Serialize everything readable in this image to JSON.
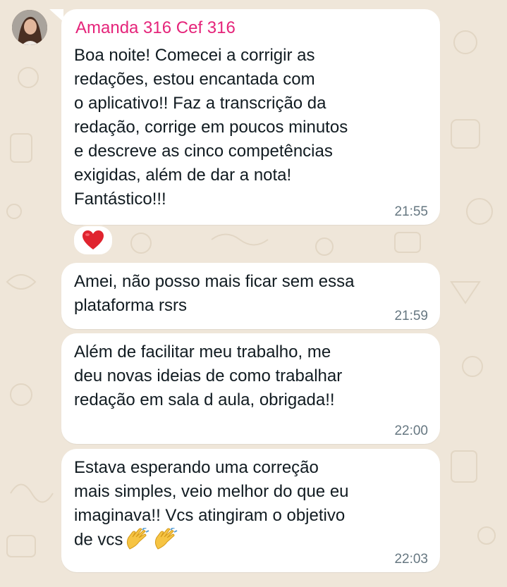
{
  "chat": {
    "sender_name": "Amanda 316 Cef 316",
    "messages": [
      {
        "text": "Boa noite! Comecei a corrigir as\nredações, estou encantada com\no aplicativo!! Faz a transcrição da\nredação, corrige em poucos minutos\ne descreve as cinco competências\nexigidas, além de dar a nota!\nFantástico!!!",
        "time": "21:55",
        "reaction": "heart-icon"
      },
      {
        "text": "Amei, não posso mais ficar sem essa\nplataforma rsrs",
        "time": "21:59"
      },
      {
        "text": "Além de facilitar meu trabalho,  me\ndeu novas ideias de como trabalhar\nredação em sala d aula, obrigada!!",
        "time": "22:00"
      },
      {
        "text": "Estava esperando uma correção\nmais simples, veio melhor do que eu\nimaginava!! Vcs atingiram o objetivo\nde vcs",
        "time": "22:03",
        "emojis": [
          "clapping-hands-icon",
          "clapping-hands-icon"
        ]
      }
    ]
  },
  "colors": {
    "background": "#efe6d9",
    "bubble": "#ffffff",
    "sender": "#e5247a",
    "text": "#111b21",
    "timestamp": "#667781",
    "heart": "#e0242f"
  }
}
